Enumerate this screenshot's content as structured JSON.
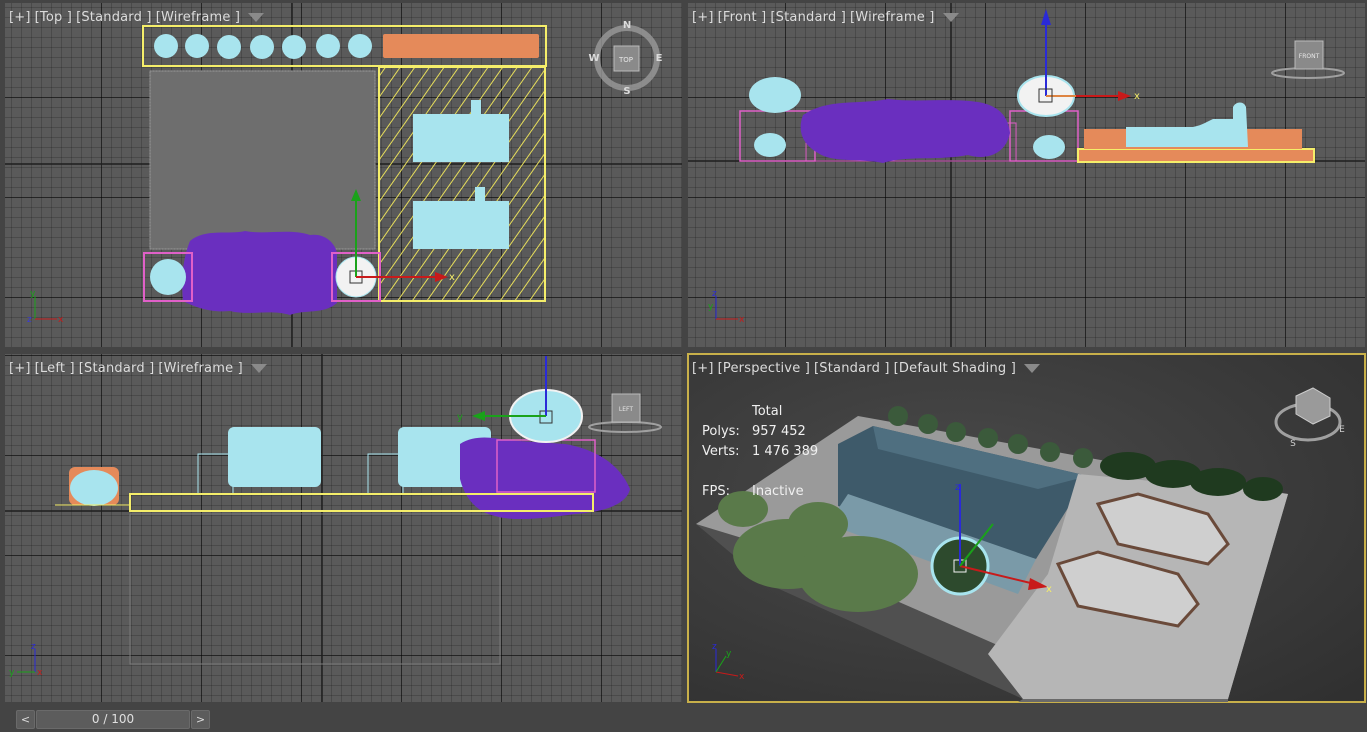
{
  "viewports": {
    "top": {
      "plus": "[+]",
      "view": "[Top ]",
      "shading": "[Standard ]",
      "mode": "[Wireframe ]"
    },
    "front": {
      "plus": "[+]",
      "view": "[Front ]",
      "shading": "[Standard ]",
      "mode": "[Wireframe ]"
    },
    "left": {
      "plus": "[+]",
      "view": "[Left ]",
      "shading": "[Standard ]",
      "mode": "[Wireframe ]"
    },
    "perspective": {
      "plus": "[+]",
      "view": "[Perspective ]",
      "shading": "[Standard ]",
      "mode": "[Default Shading ]"
    }
  },
  "compass": {
    "n": "N",
    "s": "S",
    "e": "E",
    "w": "W",
    "top": "TOP"
  },
  "viewcube": {
    "front": "FRONT",
    "left": "LEFT"
  },
  "axis_labels": {
    "x": "x",
    "y": "y",
    "z": "z"
  },
  "stats": {
    "header": "Total",
    "polys_label": "Polys:",
    "polys_value": "957 452",
    "verts_label": "Verts:",
    "verts_value": "1 476 389",
    "fps_label": "FPS:",
    "fps_value": "Inactive"
  },
  "timeline": {
    "prev": "<",
    "position": "0 / 100",
    "next": ">"
  },
  "colors": {
    "selection": "#f5ee6a",
    "shrub": "#a8e4ee",
    "planting": "#6a2fbf",
    "cushion": "#e58a5a",
    "frame": "#e060c8",
    "active_border": "#c8b04a"
  }
}
